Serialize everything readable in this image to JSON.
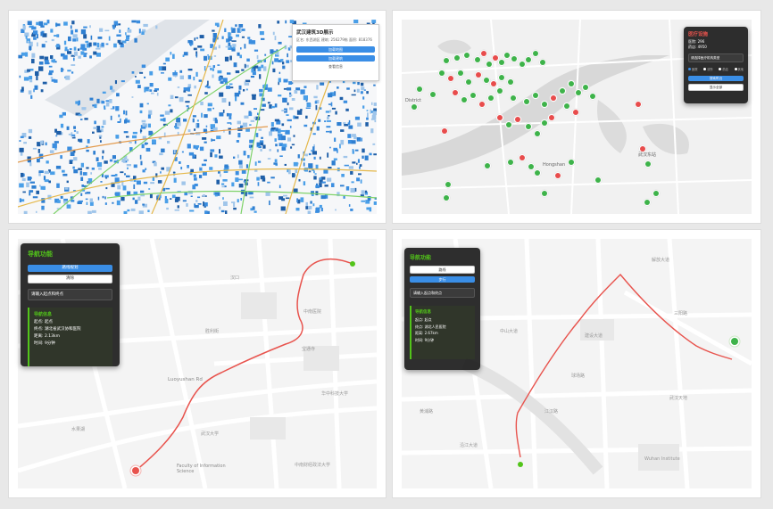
{
  "panels": {
    "building": {
      "title": "武汉建筑3D展示",
      "info": "区名: 东西湖区 建筑: 256279栋 面积: 818376",
      "btn1": "加载地图",
      "btn2": "加载建筑",
      "link": "查看信息"
    },
    "medical": {
      "title": "医疗设施",
      "stat1": "医院: 296",
      "stat2": "药店: 4950",
      "select": "请选择医疗机构类型",
      "legend": [
        "医院",
        "诊所",
        "药店",
        "其他"
      ],
      "btn_blue": "搜索附近",
      "btn_white": "显示全部",
      "map_labels": [
        "District",
        "Hongshan",
        "武汉东站"
      ]
    },
    "nav1": {
      "title": "导航功能",
      "btn_blue": "路线规划",
      "btn_white": "清除",
      "input": "请输入起点和终点",
      "card_title": "导航信息",
      "start": "起点: 起点",
      "end": "终点: 湖北省武汉协和医院",
      "distance": "距离: 2.13km",
      "time": "时间: 9分钟",
      "map_labels": [
        "Luoyushan Rd",
        "Faculty of Information Science",
        "汉口",
        "武汉大学",
        "中南医院",
        "华中科技大学",
        "胜利街",
        "宝通寺",
        "中南财经政法大学",
        "水果湖"
      ]
    },
    "nav2": {
      "title": "导航功能",
      "btn_white": "路线",
      "btn_blue": "步行",
      "input": "请输入起点和终点",
      "card_title": "导航信息",
      "start": "起点: 起点",
      "end": "终点: 湖北人民医院",
      "distance": "距离: 2.67km",
      "time": "时间: 9分钟",
      "map_labels": [
        "Wuhan Institute",
        "解放大道",
        "建设大道",
        "中山大道",
        "江汉路",
        "沿江大道",
        "武汉天地",
        "黄浦路",
        "三阳路",
        "球场路"
      ]
    }
  },
  "colors": {
    "accent_blue": "#3a8ee6",
    "route_red": "#e8534d",
    "nav_green": "#52c41a",
    "pin_green": "#3eb34a",
    "pin_red": "#e84c4c",
    "building_blue": "#2f7fd1",
    "medical_title": "#e8534d"
  }
}
